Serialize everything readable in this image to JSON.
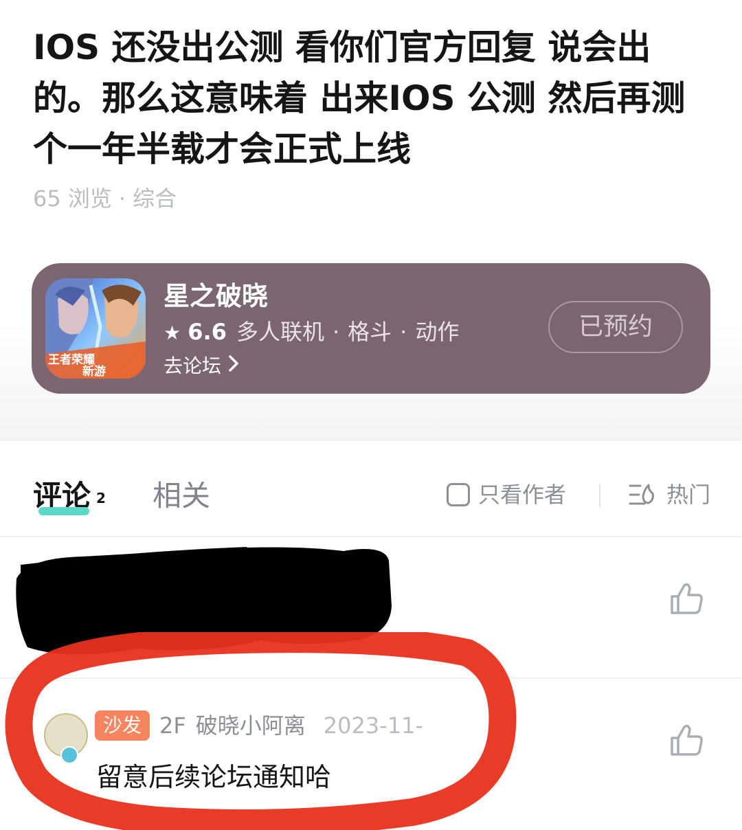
{
  "post": {
    "title": "IOS 还没出公测 看你们官方回复 说会出的。那么这意味着 出来IOS 公测 然后再测个一年半载才会正式上线",
    "views": "65 浏览",
    "separator": "·",
    "category": "综合"
  },
  "game_card": {
    "name": "星之破晓",
    "star": "★",
    "rating": "6.6",
    "tags": [
      "多人联机",
      "格斗",
      "动作"
    ],
    "tag_separator": "·",
    "forum_link": "去论坛",
    "reserve_label": "已预约",
    "icon_text": [
      "王者荣耀",
      "新游"
    ],
    "background_color": "#7a6570"
  },
  "tabs": {
    "comments_label": "评论",
    "comments_count": "2",
    "related_label": "相关",
    "author_only_label": "只看作者",
    "sort_label": "热门",
    "accent_color": "#5dd7c7"
  },
  "comments": [
    {
      "redacted": true
    },
    {
      "badge": "沙发",
      "floor": "2F",
      "author": "破晓小阿离",
      "date": "2023-11-",
      "body": "留意后续论坛通知哈",
      "badge_color": "#f5845f"
    }
  ],
  "annotation": {
    "color": "#e8321c"
  }
}
